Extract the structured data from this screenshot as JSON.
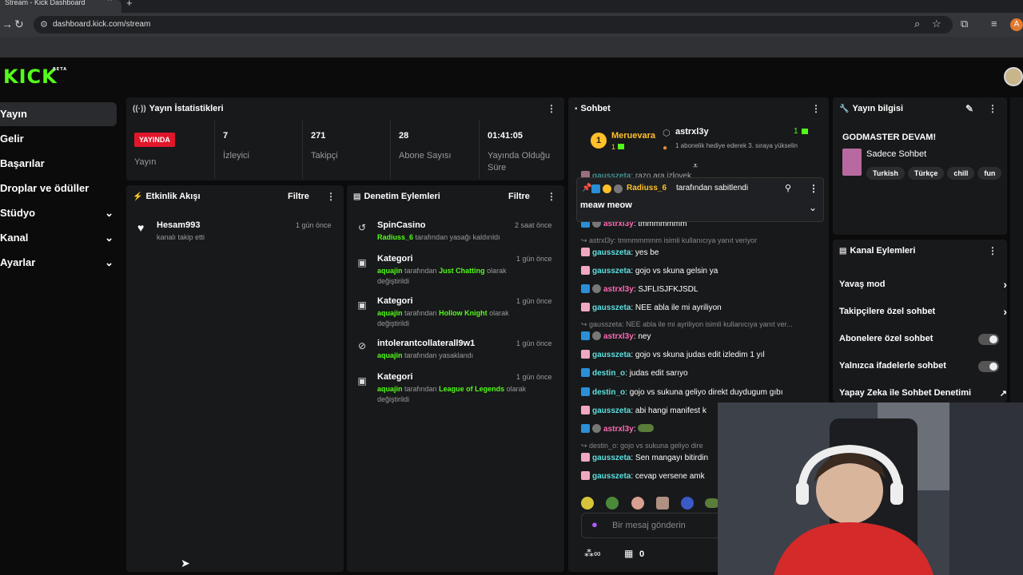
{
  "browser": {
    "tab_title": "Stream - Kick Dashboard",
    "url": "dashboard.kick.com/stream",
    "profile_initial": "A"
  },
  "header": {
    "logo": "KICK",
    "logo_badge": "BETA"
  },
  "sidebar": {
    "items": [
      {
        "label": "Yayın"
      },
      {
        "label": "Gelir"
      },
      {
        "label": "Başarılar"
      },
      {
        "label": "Droplar ve ödüller"
      },
      {
        "label": "Stüdyo"
      },
      {
        "label": "Kanal"
      },
      {
        "label": "Ayarlar"
      }
    ]
  },
  "stats": {
    "title": "Yayın İstatistikleri",
    "live_badge": "YAYINDA",
    "live_label": "Yayın",
    "items": [
      {
        "value": "7",
        "label": "İzleyici"
      },
      {
        "value": "271",
        "label": "Takipçi"
      },
      {
        "value": "28",
        "label": "Abone Sayısı"
      },
      {
        "value": "01:41:05",
        "label": "Yayında Olduğu Süre"
      }
    ]
  },
  "activity": {
    "title": "Etkinlik Akışı",
    "filter": "Filtre",
    "items": [
      {
        "user": "Hesam993",
        "text": "kanalı takip etti",
        "time": "1 gün önce"
      }
    ]
  },
  "moderation": {
    "title": "Denetim Eylemleri",
    "filter": "Filtre",
    "items": [
      {
        "title": "SpinCasino",
        "user": "Radiuss_6",
        "text": "tarafından yasağı kaldırıldı",
        "time": "2 saat önce"
      },
      {
        "title": "Kategori",
        "user": "aquajin",
        "text1": "tarafından",
        "cat": "Just Chatting",
        "text2": "olarak",
        "text3": "değiştirildi",
        "time": "1 gün önce"
      },
      {
        "title": "Kategori",
        "user": "aquajin",
        "text1": "tarafından",
        "cat": "Hollow Knight",
        "text2": "olarak",
        "text3": "değiştirildi",
        "time": "1 gün önce"
      },
      {
        "title": "intolerantcollaterall9w1",
        "user": "aquajin",
        "text": "tarafından yasaklandı",
        "time": "1 gün önce"
      },
      {
        "title": "Kategori",
        "user": "aquajin",
        "text1": "tarafından",
        "cat": "League of Legends",
        "text2": "olarak",
        "text3": "değiştirildi",
        "time": "1 gün önce"
      }
    ]
  },
  "chat": {
    "title": "Sohbet",
    "top_gifter": {
      "name": "Meruevara",
      "count": "1"
    },
    "gift_user": {
      "name": "astrxl3y",
      "count": "1",
      "text": "1 abonelik hediye ederek 3. sıraya yükselin"
    },
    "pinned": {
      "by": "Radiuss_6",
      "text": "tarafından sabitlendi",
      "message": "meaw meow"
    },
    "messages": [
      {
        "user": "gausszeta",
        "text": "razo ara izlovek",
        "color": "#5ce0e0"
      },
      {
        "user": "astrxl3y",
        "text": "tmmmmmmm",
        "color": "#ff69b4"
      },
      {
        "reply": "astrxl3y: tmmmmmmm isimli kullanıcıya yanıt veriyor"
      },
      {
        "user": "gausszeta",
        "text": "yes be",
        "color": "#5ce0e0"
      },
      {
        "user": "gausszeta",
        "text": "gojo vs skuna gelsin ya",
        "color": "#5ce0e0"
      },
      {
        "user": "astrxl3y",
        "text": "SJFLISJFKJSDL",
        "color": "#ff69b4"
      },
      {
        "user": "gausszeta",
        "text": "NEE abla ile mi ayriliyon",
        "color": "#5ce0e0"
      },
      {
        "reply": "gausszeta: NEE abla ile mi ayriliyon isimli kullanıcıya yanıt ver..."
      },
      {
        "user": "astrxl3y",
        "text": "ney",
        "color": "#ff69b4"
      },
      {
        "user": "gausszeta",
        "text": "gojo vs skuna judas edit izledim 1 yıl",
        "color": "#5ce0e0"
      },
      {
        "user": "destin_o",
        "text": "judas edit sarıyo",
        "color": "#5ce0e0"
      },
      {
        "user": "destin_o",
        "text": "gojo vs sukuna geliyo direkt duydugum gıbı",
        "color": "#5ce0e0"
      },
      {
        "user": "gausszeta",
        "text": "abi hangi manifest k",
        "color": "#5ce0e0"
      },
      {
        "user": "astrxl3y",
        "text": "",
        "color": "#ff69b4"
      },
      {
        "reply": "destin_o: gojo vs sukuna geliyo dire"
      },
      {
        "user": "gausszeta",
        "text": "Sen mangayı bitirdin",
        "color": "#5ce0e0"
      },
      {
        "user": "gausszeta",
        "text": "cevap versene amk",
        "color": "#5ce0e0"
      }
    ],
    "input_placeholder": "Bir mesaj gönderin",
    "footer_count": "0"
  },
  "stream_info": {
    "title": "Yayın bilgisi",
    "stream_title": "GODMASTER DEVAM!",
    "category": "Sadece Sohbet",
    "tags": [
      "Turkish",
      "Türkçe",
      "chill",
      "fun"
    ]
  },
  "channel_actions": {
    "title": "Kanal Eylemleri",
    "items": [
      {
        "label": "Yavaş mod"
      },
      {
        "label": "Takipçilere özel sohbet"
      },
      {
        "label": "Abonelere özel sohbet"
      },
      {
        "label": "Yalnızca ifadelerle sohbet"
      },
      {
        "label": "Yapay Zeka ile Sohbet Denetimi"
      }
    ]
  },
  "colors": {
    "accent": "#53fc18",
    "live": "#e0162b",
    "panel": "#18191b"
  }
}
